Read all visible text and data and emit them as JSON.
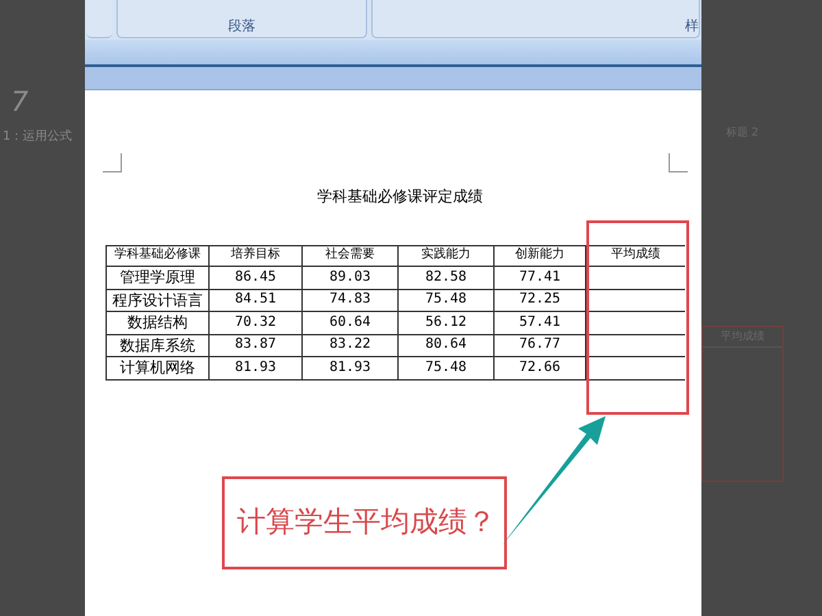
{
  "background": {
    "left_texts": [
      "7",
      "1：运用公式"
    ],
    "right_texts": [
      "标题 2",
      "平均成绩"
    ]
  },
  "ribbon": {
    "groups": [
      "段落",
      "样"
    ]
  },
  "document": {
    "title": "学科基础必修课评定成绩",
    "table": {
      "columns": [
        "学科基础必修课",
        "培养目标",
        "社会需要",
        "实践能力",
        "创新能力",
        "平均成绩"
      ],
      "rows": [
        [
          "管理学原理",
          "86.45",
          "89.03",
          "82.58",
          "77.41",
          ""
        ],
        [
          "程序设计语言",
          "84.51",
          "74.83",
          "75.48",
          "72.25",
          ""
        ],
        [
          "数据结构",
          "70.32",
          "60.64",
          "56.12",
          "57.41",
          ""
        ],
        [
          "数据库系统",
          "83.87",
          "83.22",
          "80.64",
          "76.77",
          ""
        ],
        [
          "计算机网络",
          "81.93",
          "81.93",
          "75.48",
          "72.66",
          ""
        ]
      ]
    },
    "callout": "计算学生平均成绩？"
  }
}
